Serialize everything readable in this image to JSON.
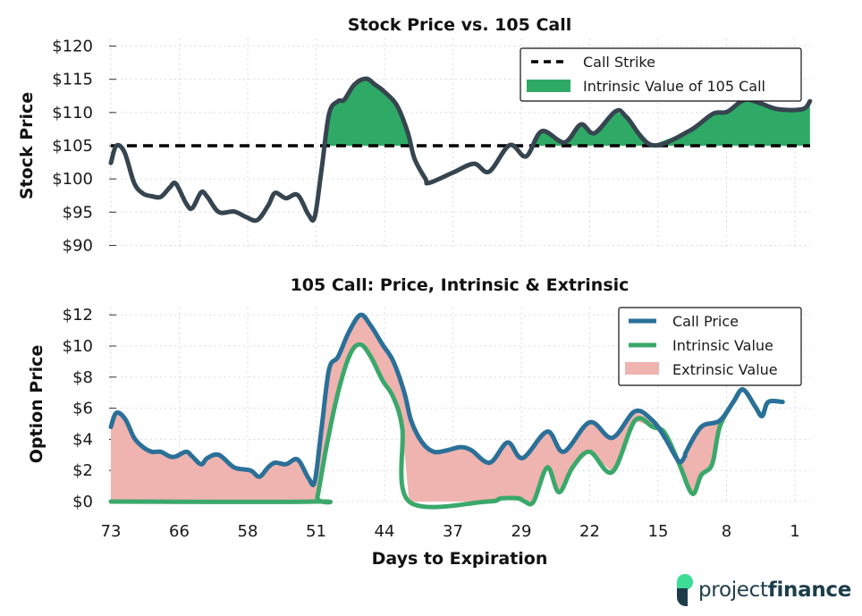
{
  "colors": {
    "stock_line": "#36454f",
    "strike_line": "#000000",
    "intrinsic_fill": "#2eaa66",
    "call_price_line": "#2a7098",
    "intrinsic_line": "#3aa86a",
    "extrinsic_fill": "#efb3b0",
    "logo_green": "#3ddc97",
    "logo_dark": "#1d3d4a"
  },
  "brand": {
    "prefix": "project",
    "suffix": "finance"
  },
  "chart_data": [
    {
      "type": "line",
      "title": "Stock Price vs. 105 Call",
      "xlabel": "",
      "ylabel": "Stock Price",
      "ylim": [
        90,
        120
      ],
      "yticks": [
        90,
        95,
        100,
        105,
        110,
        115,
        120
      ],
      "ytick_labels": [
        "$90",
        "$95",
        "$100",
        "$105",
        "$110",
        "$115",
        "$120"
      ],
      "x_tick_labels": [
        "73",
        "66",
        "58",
        "51",
        "44",
        "37",
        "29",
        "22",
        "15",
        "8",
        "1"
      ],
      "x_note": "x is tick-position index: 0 = 73 days, 10 = 1 day to expiration",
      "xlim": [
        0,
        10.22
      ],
      "grid": true,
      "strike": 105,
      "legend": {
        "position": "top-right",
        "entries": [
          "Call Strike",
          "Intrinsic Value of 105 Call"
        ]
      },
      "series": [
        {
          "name": "Stock Price",
          "x": [
            0,
            0.08,
            0.2,
            0.34,
            0.47,
            0.6,
            0.73,
            0.86,
            0.95,
            1.1,
            1.19,
            1.32,
            1.41,
            1.58,
            1.8,
            1.97,
            2.14,
            2.3,
            2.4,
            2.56,
            2.73,
            2.89,
            2.98,
            3.08,
            3.19,
            3.32,
            3.41,
            3.56,
            3.73,
            3.86,
            3.99,
            4.18,
            4.34,
            4.44,
            4.6,
            4.65,
            5.01,
            5.31,
            5.53,
            5.83,
            6.07,
            6.3,
            6.63,
            6.87,
            7.07,
            7.38,
            7.54,
            7.91,
            8.45,
            8.8,
            9.01,
            9.26,
            9.49,
            9.75,
            10.11,
            10.22
          ],
          "values": [
            102.4,
            105.0,
            104.0,
            99.4,
            97.8,
            97.4,
            97.3,
            98.7,
            99.3,
            96.3,
            95.6,
            98.0,
            97.3,
            95.0,
            95.1,
            94.3,
            93.8,
            96.0,
            97.9,
            97.1,
            97.6,
            94.6,
            94.3,
            101.4,
            109.8,
            111.7,
            111.9,
            114.2,
            115.1,
            114.2,
            113.2,
            111.1,
            107.0,
            103.0,
            100.0,
            99.4,
            101.0,
            102.3,
            101.1,
            105.1,
            103.4,
            107.2,
            105.5,
            108.2,
            106.9,
            110.2,
            109.3,
            105.1,
            107.2,
            109.8,
            110.1,
            111.9,
            111.4,
            110.5,
            110.5,
            111.7
          ]
        }
      ]
    },
    {
      "type": "area",
      "title": "105 Call: Price, Intrinsic & Extrinsic",
      "xlabel": "Days to Expiration",
      "ylabel": "Option Price",
      "ylim": [
        0,
        12
      ],
      "yticks": [
        0,
        2,
        4,
        6,
        8,
        10,
        12
      ],
      "ytick_labels": [
        "$0",
        "$2",
        "$4",
        "$6",
        "$8",
        "$10",
        "$12"
      ],
      "x_tick_labels": [
        "73",
        "66",
        "58",
        "51",
        "44",
        "37",
        "29",
        "22",
        "15",
        "8",
        "1"
      ],
      "xlim": [
        0,
        10.22
      ],
      "grid": true,
      "legend": {
        "position": "top-right",
        "entries": [
          "Call Price",
          "Intrinsic Value",
          "Extrinsic Value"
        ]
      },
      "series": [
        {
          "name": "Call Price",
          "x": [
            0,
            0.08,
            0.21,
            0.34,
            0.47,
            0.6,
            0.73,
            0.86,
            0.95,
            1.1,
            1.19,
            1.32,
            1.41,
            1.58,
            1.8,
            2.04,
            2.17,
            2.3,
            2.4,
            2.56,
            2.73,
            2.89,
            2.98,
            3.08,
            3.19,
            3.32,
            3.48,
            3.65,
            3.8,
            3.97,
            4.13,
            4.29,
            4.39,
            4.55,
            4.72,
            4.92,
            5.11,
            5.27,
            5.54,
            5.8,
            6.02,
            6.38,
            6.62,
            7.0,
            7.33,
            7.66,
            7.92,
            8.1,
            8.3,
            8.39,
            8.41,
            8.63,
            8.9,
            9.1,
            9.24,
            9.42,
            9.52,
            9.61,
            9.82
          ],
          "values": [
            4.8,
            5.7,
            5.3,
            4.1,
            3.5,
            3.2,
            3.2,
            2.9,
            2.9,
            3.2,
            2.9,
            2.4,
            2.8,
            3.0,
            2.2,
            2.0,
            1.6,
            2.2,
            2.5,
            2.4,
            2.7,
            1.5,
            1.3,
            4.7,
            8.5,
            9.3,
            10.9,
            12.0,
            11.3,
            10.1,
            9.0,
            7.0,
            5.2,
            3.8,
            3.2,
            3.3,
            3.5,
            3.3,
            2.5,
            3.8,
            2.8,
            4.5,
            3.2,
            5.1,
            4.1,
            5.8,
            5.2,
            4.1,
            2.6,
            2.9,
            3.2,
            4.8,
            5.2,
            6.4,
            7.2,
            6.1,
            5.5,
            6.4,
            6.4
          ]
        },
        {
          "name": "Intrinsic Value",
          "x": [
            0,
            2.98,
            3.02,
            3.15,
            3.32,
            3.5,
            3.65,
            3.8,
            3.97,
            4.13,
            4.26,
            4.36,
            5.5,
            5.7,
            5.96,
            6.05,
            6.18,
            6.38,
            6.55,
            6.75,
            7.0,
            7.33,
            7.66,
            7.92,
            8.1,
            8.31,
            8.5,
            8.63,
            8.79,
            8.9,
            9.1,
            9.24,
            9.42,
            9.52,
            9.61,
            9.82
          ],
          "values": [
            0,
            0,
            0.3,
            3.5,
            7.0,
            9.5,
            10.1,
            9.3,
            7.8,
            6.7,
            4.7,
            0,
            0,
            0.2,
            0.2,
            0,
            0,
            2.2,
            0.6,
            2.2,
            3.2,
            1.9,
            5.2,
            4.8,
            4.4,
            2.4,
            0.5,
            1.7,
            2.4,
            4.8,
            6.4,
            7.2,
            6.1,
            5.5,
            6.4,
            6.4
          ]
        }
      ]
    }
  ]
}
